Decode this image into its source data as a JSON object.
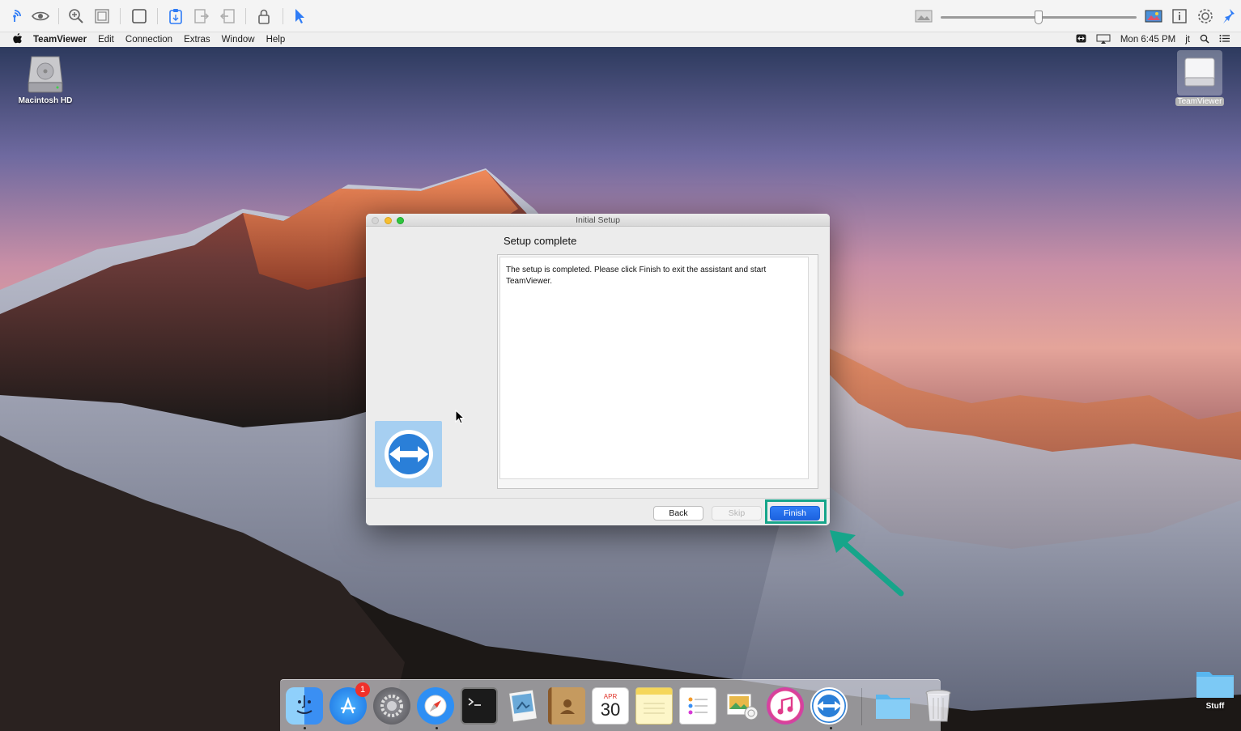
{
  "toolbar": {
    "icons": [
      "remote-control-icon",
      "view-icon",
      "zoom-icon",
      "fit-screen-icon",
      "fullscreen-icon",
      "clipboard-icon",
      "file-transfer-icon",
      "file-transfer-back-icon",
      "lock-icon",
      "pointer-icon",
      "quality-low-icon",
      "quality-high-icon",
      "info-icon",
      "settings-icon",
      "pin-icon"
    ],
    "quality_slider_fraction": 0.5
  },
  "menubar": {
    "apple": "",
    "app_name": "TeamViewer",
    "items": [
      "Edit",
      "Connection",
      "Extras",
      "Window",
      "Help"
    ],
    "clock": "Mon 6:45 PM",
    "user": "jt"
  },
  "desktop": {
    "icons": [
      {
        "label": "Macintosh HD",
        "icon": "hard-drive-icon"
      },
      {
        "label": "TeamViewer",
        "icon": "disk-image-icon"
      },
      {
        "label": "Stuff",
        "icon": "folder-icon"
      }
    ]
  },
  "dialog": {
    "window_title": "Initial Setup",
    "step_title": "Setup complete",
    "message": "The setup is completed. Please click Finish to exit the assistant and start TeamViewer.",
    "buttons": {
      "back": "Back",
      "skip": "Skip",
      "finish": "Finish"
    },
    "accent": "#2f7cf6"
  },
  "annotation": {
    "color": "#16a58a"
  },
  "dock": {
    "apps": [
      "Finder",
      "App Store",
      "System Preferences",
      "Safari",
      "Terminal",
      "Preview",
      "Contacts",
      "Calendar",
      "Notes",
      "Reminders",
      "Photos",
      "iTunes",
      "TeamViewer",
      "Downloads",
      "Trash"
    ],
    "app_store_badge": "1",
    "calendar_month": "APR",
    "calendar_day": "30"
  }
}
